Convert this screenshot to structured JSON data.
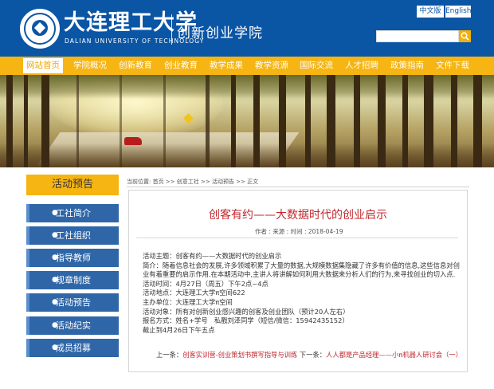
{
  "header": {
    "university_cn": "大连理工大学",
    "university_en": "DALIAN UNIVERSITY OF TECHNOLOGY",
    "school_name": "创新创业学院",
    "lang_cn": "中文版",
    "lang_en": "English",
    "search_placeholder": ""
  },
  "nav": {
    "items": [
      "网站首页",
      "学院概况",
      "创新教育",
      "创业教育",
      "教学成果",
      "教学资源",
      "国际交流",
      "人才招聘",
      "政策指南",
      "文件下载"
    ],
    "active_index": 0
  },
  "sidebar": {
    "title": "活动预告",
    "items": [
      "工社简介",
      "工社组织",
      "指导教师",
      "规章制度",
      "活动预告",
      "活动纪实",
      "成员招募"
    ]
  },
  "breadcrumb": "当前位置: 首页 >> 创意工社 >> 活动预告 >> 正文",
  "article": {
    "title": "创客有约——大数据时代的创业启示",
    "meta": "作者 : 来源 : 时间 : 2018-04-19",
    "body": [
      "活动主题：创客有约——大数据时代的创业启示",
      "简介：随着信息社会的发展,许多领域积累了大量的数据,大规模数据集隐藏了许多有价值的信息,这些信息对创业有着重要的启示作用.在本期活动中,主讲人将讲解如何利用大数据来分析人们的行为,来寻找创业的切入点.",
      "活动时间：4月27日（周五）下午2点~4点",
      "活动地点：大连理工大学π空间622",
      "主办单位：大连理工大学π空间",
      "活动对象：所有对创新创业感兴趣的创客及创业团队（预计20人左右）",
      "报名方式：姓名+学号　私戳刘泽同学（短信/微信：15942435152）",
      "截止到4月26日下午五点"
    ],
    "prev_label": "上一条：",
    "prev_link": "创客实训营-创业策划书撰写指导与训练",
    "next_label": " 下一条：",
    "next_link": "人人都是产品经理——小π机器人研讨会（一）"
  },
  "colors": {
    "brand_blue": "#0b55a5",
    "nav_gold": "#f6b512",
    "sidebar_blue": "#2f66a8",
    "title_red": "#c1272d"
  }
}
